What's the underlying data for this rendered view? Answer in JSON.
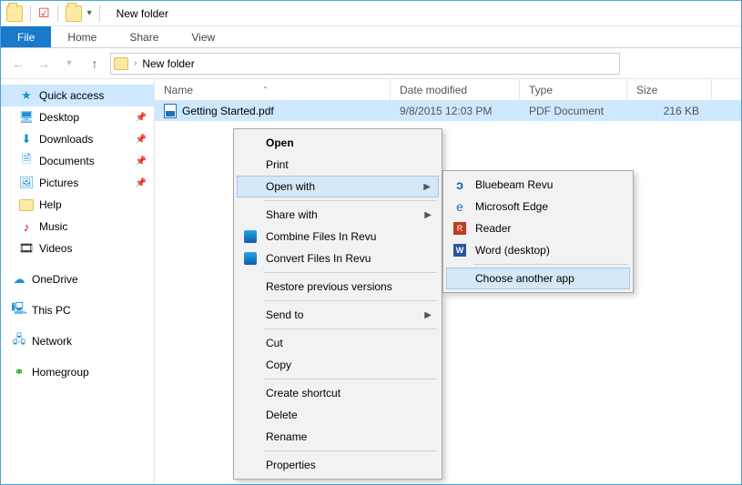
{
  "title": "New folder",
  "ribbon": {
    "file": "File",
    "home": "Home",
    "share": "Share",
    "view": "View"
  },
  "addr": {
    "folder": "New folder"
  },
  "sidebar": {
    "quick": "Quick access",
    "items": [
      "Desktop",
      "Downloads",
      "Documents",
      "Pictures",
      "Help",
      "Music",
      "Videos"
    ],
    "onedrive": "OneDrive",
    "thispc": "This PC",
    "network": "Network",
    "homegroup": "Homegroup"
  },
  "cols": {
    "name": "Name",
    "date": "Date modified",
    "type": "Type",
    "size": "Size"
  },
  "file": {
    "name": "Getting Started.pdf",
    "date": "9/8/2015 12:03 PM",
    "type": "PDF Document",
    "size": "216 KB"
  },
  "menu1": {
    "open": "Open",
    "print": "Print",
    "openwith": "Open with",
    "sharewith": "Share with",
    "combine": "Combine Files In Revu",
    "convert": "Convert Files In Revu",
    "restore": "Restore previous versions",
    "sendto": "Send to",
    "cut": "Cut",
    "copy": "Copy",
    "shortcut": "Create shortcut",
    "delete": "Delete",
    "rename": "Rename",
    "props": "Properties"
  },
  "menu2": {
    "bluebeam": "Bluebeam Revu",
    "edge": "Microsoft Edge",
    "reader": "Reader",
    "word": "Word (desktop)",
    "choose": "Choose another app"
  }
}
